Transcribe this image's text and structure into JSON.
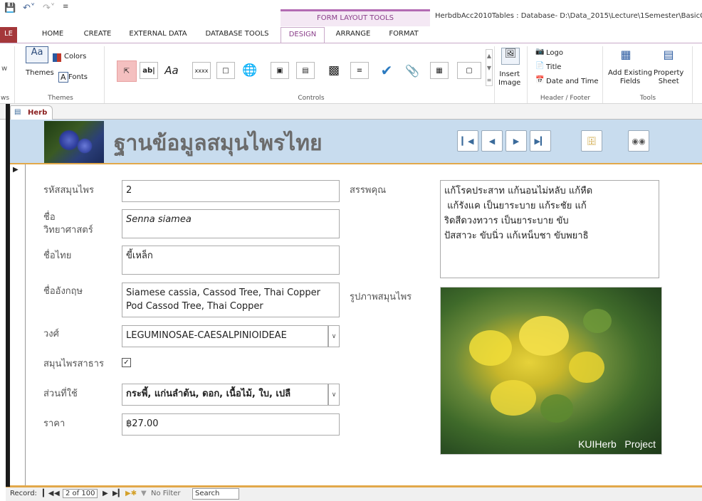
{
  "ribbon": {
    "file_tab": "LE",
    "tabs": [
      "HOME",
      "CREATE",
      "EXTERNAL DATA",
      "DATABASE TOOLS",
      "DESIGN",
      "ARRANGE",
      "FORMAT"
    ],
    "context_title": "FORM LAYOUT TOOLS",
    "doc_title": "HerbdbAcc2010Tables : Database- D:\\Data_2015\\Lecture\\1Semester\\BasicCo",
    "left_stub": "w",
    "left_stub_group": "ws",
    "themes_label": "Themes",
    "colors_label": "Colors",
    "fonts_label": "Fonts",
    "themes_group": "Themes",
    "controls_group": "Controls",
    "insert_image": "Insert\nImage",
    "logo": "Logo",
    "title": "Title",
    "date_time": "Date and Time",
    "header_footer_group": "Header / Footer",
    "add_existing": "Add Existing\nFields",
    "property_sheet": "Property\nSheet",
    "tools_group": "Tools",
    "text_box_glyph": "ab|",
    "label_glyph": "Aa",
    "button_glyph": "xxxx"
  },
  "document": {
    "tab_label": "Herb"
  },
  "form": {
    "title": "ฐานข้อมูลสมุนไพรไทย",
    "fields": {
      "id_label": "รหัสสมุนไพร",
      "id_value": "2",
      "sci_label": "ชื่อ\nวิทยาศาสตร์",
      "sci_value": "Senna siamea",
      "thai_label": "ชื่อไทย",
      "thai_value": "ขี้เหล็ก",
      "eng_label": "ชื่ออังกฤษ",
      "eng_value": "Siamese cassia, Cassod Tree, Thai Copper Pod Cassod Tree, Thai Copper",
      "family_label": "วงศ์",
      "family_value": "LEGUMINOSAE-CAESALPINIOIDEAE",
      "public_label": "สมุนไพรสาธาร",
      "public_checked": true,
      "parts_label": "ส่วนที่ใช้",
      "parts_value": "กระพี้, แก่นลำต้น, ดอก, เนื้อไม้, ใบ, เปลื",
      "price_label": "ราคา",
      "price_value": "฿27.00",
      "props_label": "สรรพคุณ",
      "props_value": "แก้โรคประสาท แก้นอนไม่หลับ แก้หืด\n แก้รังแค เป็นยาระบาย แก้ระชัย แก้\nริดสีดวงทวาร เป็นยาระบาย ขับ\nปัสสาวะ ขับนิ่ว แก้เหน็บชา ขับพยาธิ",
      "photo_label": "รูปภาพสมุนไพร",
      "photo_caption": "KUIHerb   Project"
    }
  },
  "status": {
    "record_label": "Record:",
    "record_pos": "2 of 100",
    "no_filter": "No Filter",
    "search": "Search"
  },
  "colors": {
    "accent": "#a4373a",
    "context": "#b36bb3",
    "header_bg": "#c8dcee",
    "orange": "#e2a84a"
  }
}
